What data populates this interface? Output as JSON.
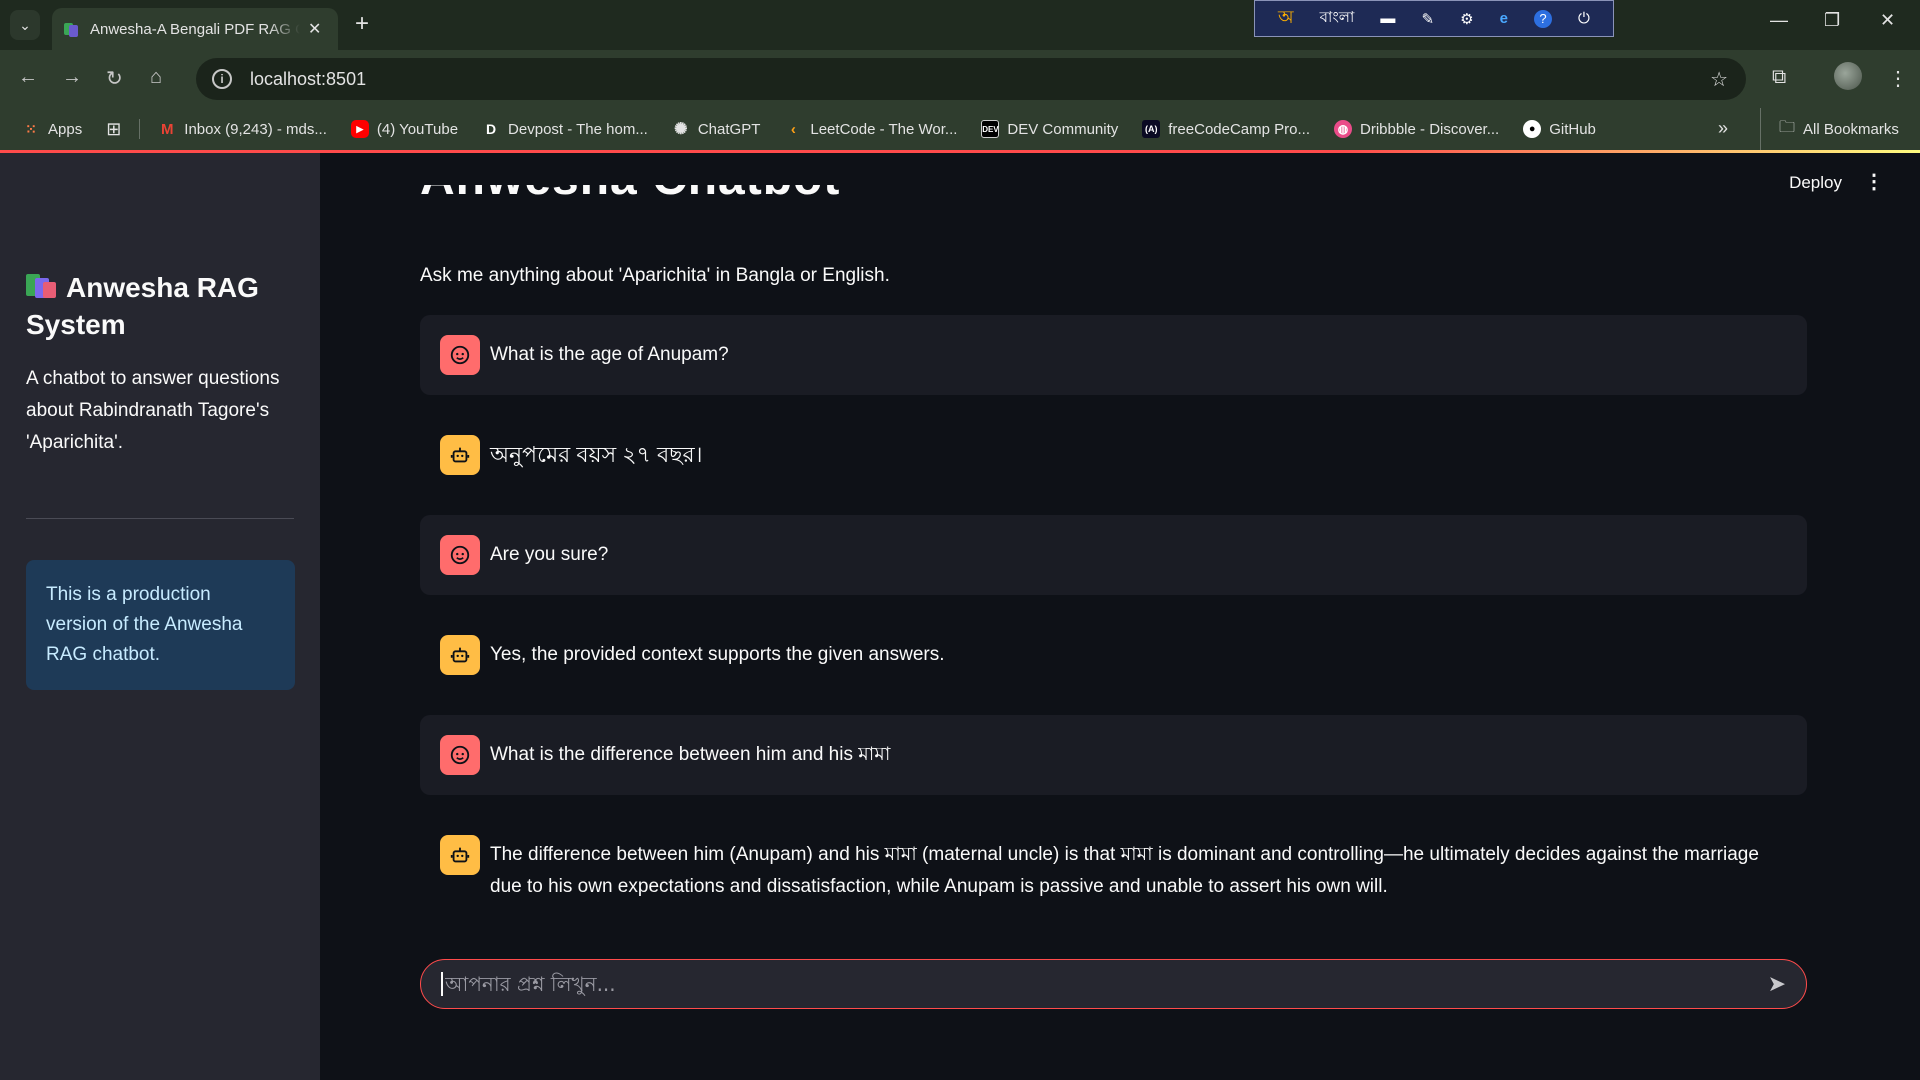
{
  "browser": {
    "tab_title": "Anwesha-A Bengali PDF RAG Chatbot",
    "url": "localhost:8501",
    "ime": {
      "label": "বাংলা"
    },
    "bookmarks": [
      {
        "label": "Apps",
        "icon": "apps-grid-icon"
      },
      {
        "label": "Inbox (9,243) - mds...",
        "icon": "gmail-icon"
      },
      {
        "label": "(4) YouTube",
        "icon": "youtube-icon"
      },
      {
        "label": "Devpost - The hom...",
        "icon": "devpost-icon"
      },
      {
        "label": "ChatGPT",
        "icon": "chatgpt-icon"
      },
      {
        "label": "LeetCode - The Wor...",
        "icon": "leetcode-icon"
      },
      {
        "label": "DEV Community",
        "icon": "dev-icon"
      },
      {
        "label": "freeCodeCamp Pro...",
        "icon": "freecodecamp-icon"
      },
      {
        "label": "Dribbble - Discover...",
        "icon": "dribbble-icon"
      },
      {
        "label": "GitHub",
        "icon": "github-icon"
      }
    ],
    "all_bookmarks": "All Bookmarks"
  },
  "sidebar": {
    "title": "Anwesha RAG System",
    "description": "A chatbot to answer questions about Rabindranath Tagore's 'Aparichita'.",
    "info": "This is a production version of the Anwesha RAG chatbot."
  },
  "main": {
    "deploy_label": "Deploy",
    "title": "Anwesha Chatbot",
    "subtitle": "Ask me anything about 'Aparichita' in Bangla or English.",
    "messages": [
      {
        "role": "user",
        "text": "What is the age of Anupam?"
      },
      {
        "role": "assistant",
        "text": "অনুপমের বয়স ২৭ বছর।"
      },
      {
        "role": "user",
        "text": "Are you sure?"
      },
      {
        "role": "assistant",
        "text": "Yes, the provided context supports the given answers."
      },
      {
        "role": "user",
        "text": "What is the difference between him and his মামা"
      },
      {
        "role": "assistant",
        "text": "The difference between him (Anupam) and his মামা (maternal uncle) is that মামা is dominant and controlling—he ultimately decides against the marriage due to his own expectations and dissatisfaction, while Anupam is passive and unable to assert his own will."
      }
    ],
    "input_placeholder": "আপনার প্রশ্ন লিখুন..."
  },
  "colors": {
    "background": "#0e1117",
    "sidebar": "#262730",
    "accent": "#ff4b4b",
    "user_avatar": "#ff6c6c",
    "assistant_avatar": "#ffbd45",
    "info_box": "#1e3a57"
  }
}
